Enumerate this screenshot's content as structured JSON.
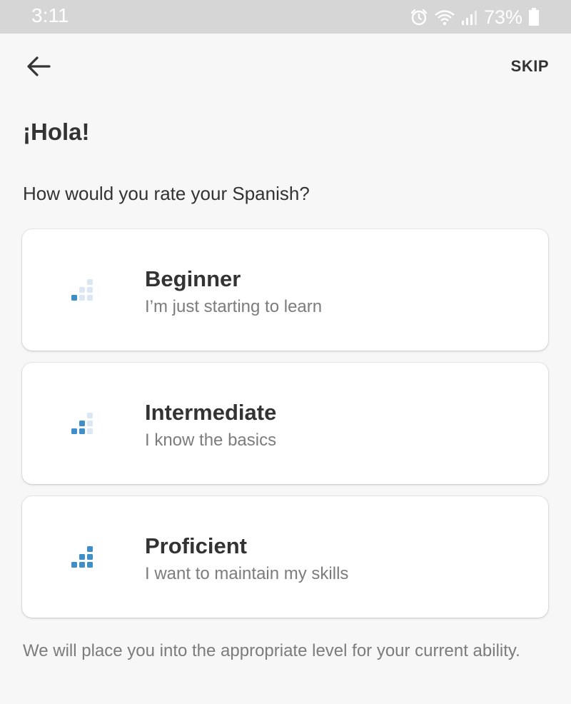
{
  "status_bar": {
    "time": "3:11",
    "battery_percent": "73%",
    "icons": [
      "alarm-icon",
      "wifi-icon",
      "signal-icon",
      "battery-icon"
    ]
  },
  "header": {
    "back_icon": "arrow-left-icon",
    "skip_label": "SKIP"
  },
  "greeting": "¡Hola!",
  "question": "How would you rate your Spanish?",
  "options": [
    {
      "title": "Beginner",
      "subtitle": "I’m just starting to learn",
      "icon": "level-1-icon",
      "level": 1
    },
    {
      "title": "Intermediate",
      "subtitle": "I know the basics",
      "icon": "level-2-icon",
      "level": 2
    },
    {
      "title": "Proficient",
      "subtitle": "I want to maintain my skills",
      "icon": "level-3-icon",
      "level": 3
    }
  ],
  "footer_note": "We will place you into the appropriate level for your current ability.",
  "colors": {
    "accent": "#3d8ec9",
    "accent_light": "#dbe8f4",
    "text_primary": "#333333",
    "text_secondary": "#7c7c7c",
    "status_bar": "#d6d6d6",
    "background": "#f7f7f7"
  }
}
